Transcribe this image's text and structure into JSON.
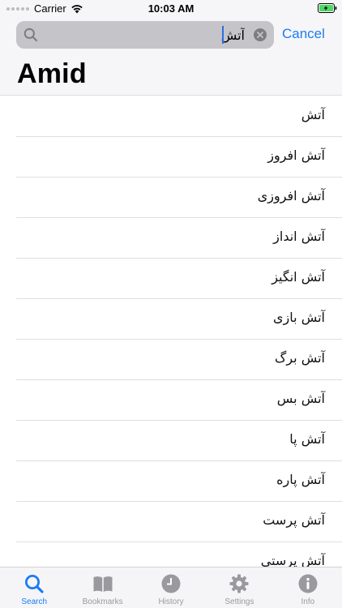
{
  "status_bar": {
    "carrier": "Carrier",
    "time": "10:03 AM"
  },
  "search": {
    "value": "آتش",
    "cancel_label": "Cancel"
  },
  "page_title": "Amid",
  "results": [
    "آتش",
    "آتش افروز",
    "آتش افروزی",
    "آتش انداز",
    "آتش انگیز",
    "آتش بازی",
    "آتش برگ",
    "آتش بس",
    "آتش پا",
    "آتش پاره",
    "آتش پرست",
    "آتش پرستی"
  ],
  "tabs": [
    {
      "label": "Search",
      "icon": "search-icon",
      "active": true
    },
    {
      "label": "Bookmarks",
      "icon": "book-icon",
      "active": false
    },
    {
      "label": "History",
      "icon": "clock-icon",
      "active": false
    },
    {
      "label": "Settings",
      "icon": "gear-icon",
      "active": false
    },
    {
      "label": "Info",
      "icon": "info-icon",
      "active": false
    }
  ],
  "colors": {
    "accent": "#1a7cf3",
    "inactive": "#9a9a9e",
    "battery": "#4cd964"
  }
}
